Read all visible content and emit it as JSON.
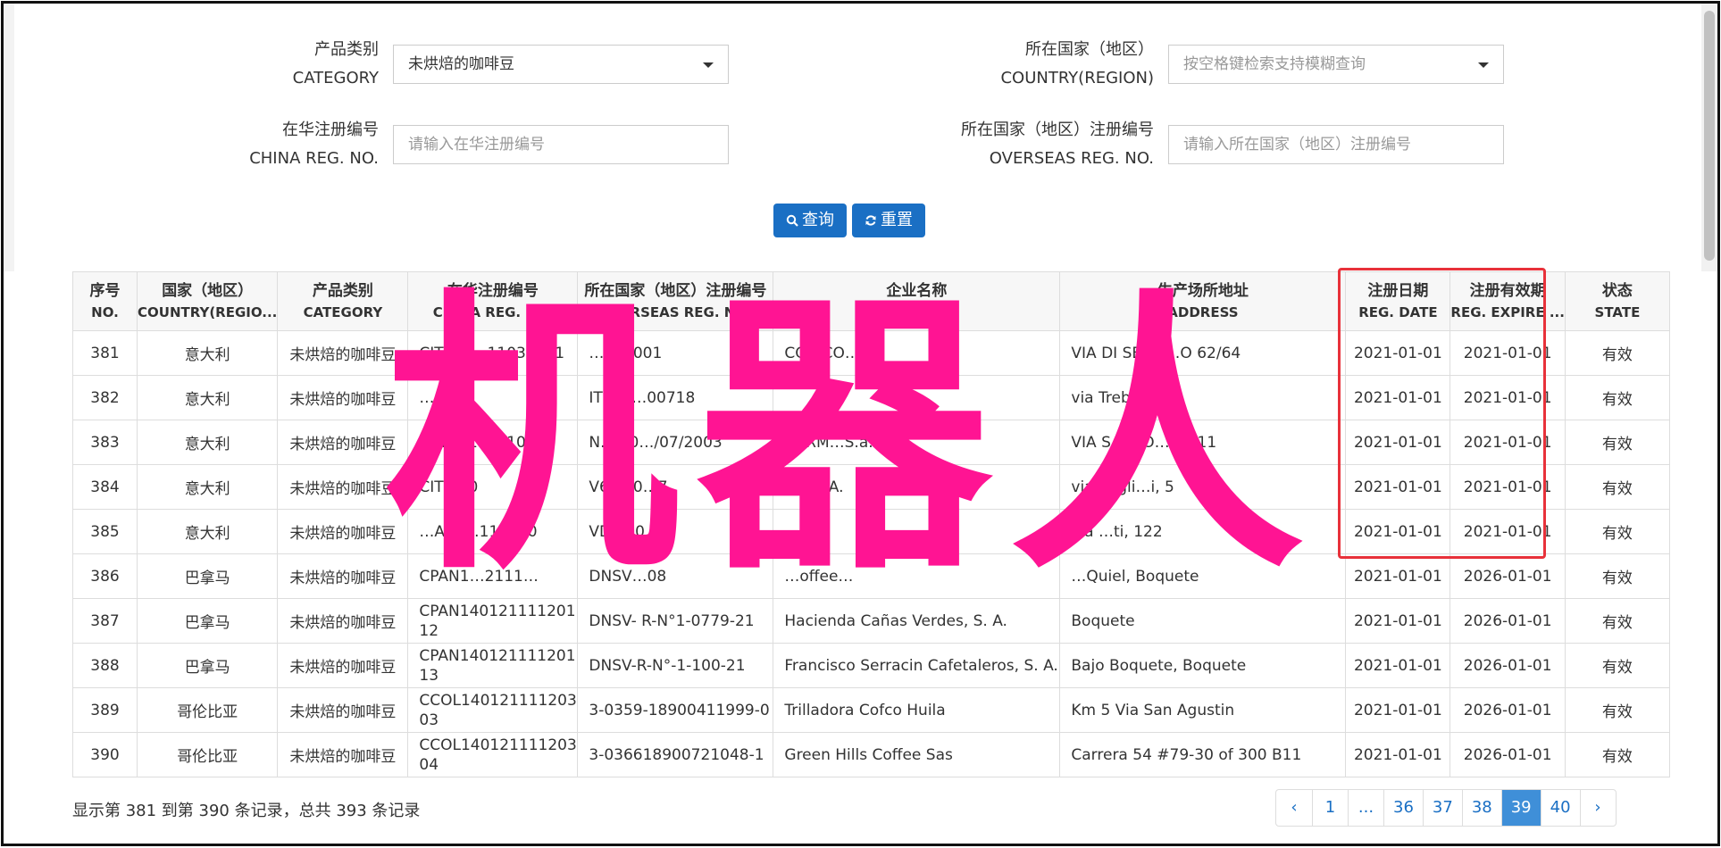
{
  "filters": {
    "category": {
      "label_cn": "产品类别",
      "label_en": "CATEGORY",
      "value": "未烘焙的咖啡豆"
    },
    "country": {
      "label_cn": "所在国家（地区）",
      "label_en": "COUNTRY(REGION)",
      "placeholder": "按空格键检索支持模糊查询"
    },
    "china_reg": {
      "label_cn": "在华注册编号",
      "label_en": "CHINA REG. NO.",
      "placeholder": "请输入在华注册编号"
    },
    "overseas_reg": {
      "label_cn": "所在国家（地区）注册编号",
      "label_en": "OVERSEAS REG. NO.",
      "placeholder": "请输入所在国家（地区）注册编号"
    }
  },
  "buttons": {
    "search": "查询",
    "reset": "重置"
  },
  "table": {
    "headers": [
      {
        "cn": "序号",
        "en": "NO."
      },
      {
        "cn": "国家（地区）",
        "en": "COUNTRY(REGIO..."
      },
      {
        "cn": "产品类别",
        "en": "CATEGORY"
      },
      {
        "cn": "在华注册编号",
        "en": "CHINA REG. NO."
      },
      {
        "cn": "所在国家（地区）注册编号",
        "en": "OVERSEAS REG. NO."
      },
      {
        "cn": "企业名称",
        "en": "NAME"
      },
      {
        "cn": "生产场所地址",
        "en": "ADDRESS"
      },
      {
        "cn": "注册日期",
        "en": "REG. DATE"
      },
      {
        "cn": "注册有效期",
        "en": "REG. EXPIRE ..."
      },
      {
        "cn": "状态",
        "en": "STATE"
      }
    ],
    "rows": [
      [
        "381",
        "意大利",
        "未烘焙的咖啡豆",
        "CITA14…11031001",
        "…500001",
        "CO…CO…",
        "VIA DI SEMB…O 62/64",
        "2021-01-01",
        "2021-01-01",
        "有效"
      ],
      [
        "382",
        "意大利",
        "未烘焙的咖啡豆",
        "…001",
        "IT205…00718",
        "",
        "via Trebbia 2…",
        "2021-01-01",
        "2021-01-01",
        "有效"
      ],
      [
        "383",
        "意大利",
        "未烘焙的咖啡豆",
        "CITA…11031001",
        "N. 760…/07/2003",
        "TORM…S.a.a",
        "VIA SACCO…TTI 11",
        "2021-01-01",
        "2021-01-01",
        "有效"
      ],
      [
        "384",
        "意大利",
        "未烘焙的咖啡豆",
        "CIT…00",
        "V69.00…7",
        "…S.p.A.",
        "via degli…i, 5",
        "2021-01-01",
        "2021-01-01",
        "有效"
      ],
      [
        "385",
        "意大利",
        "未烘焙的咖啡豆",
        "…A14…110310",
        "VD6.00…7",
        "…A.",
        "via …ti, 122",
        "2021-01-01",
        "2021-01-01",
        "有效"
      ],
      [
        "386",
        "巴拿马",
        "未烘焙的咖啡豆",
        "CPAN1…2111…",
        "DNSV…08",
        "…offee…",
        "…Quiel, Boquete",
        "2021-01-01",
        "2026-01-01",
        "有效"
      ],
      [
        "387",
        "巴拿马",
        "未烘焙的咖啡豆",
        "CPAN14012111120112",
        "DNSV- R-N°1-0779-21",
        "Hacienda Cañas Verdes, S. A.",
        "Boquete",
        "2021-01-01",
        "2026-01-01",
        "有效"
      ],
      [
        "388",
        "巴拿马",
        "未烘焙的咖啡豆",
        "CPAN14012111120113",
        "DNSV-R-N°-1-100-21",
        "Francisco Serracin Cafetaleros, S. A.",
        "Bajo Boquete, Boquete",
        "2021-01-01",
        "2026-01-01",
        "有效"
      ],
      [
        "389",
        "哥伦比亚",
        "未烘焙的咖啡豆",
        "CCOL14012111120303",
        "3-0359-18900411999-0",
        "Trilladora Cofco Huila",
        "Km 5 Via San Agustin",
        "2021-01-01",
        "2026-01-01",
        "有效"
      ],
      [
        "390",
        "哥伦比亚",
        "未烘焙的咖啡豆",
        "CCOL14012111120304",
        "3-036618900721048-1",
        "Green Hills Coffee Sas",
        "Carrera 54 #79-30 of 300 B11",
        "2021-01-01",
        "2026-01-01",
        "有效"
      ]
    ]
  },
  "watermark": "机器人",
  "footer": {
    "summary": "显示第 381 到第 390 条记录，总共 393 条记录"
  },
  "pagination": [
    "‹",
    "1",
    "...",
    "36",
    "37",
    "38",
    "39",
    "40",
    "›"
  ],
  "pagination_active": "39",
  "colors": {
    "primary": "#1a6fc4",
    "highlight_box": "#e8313a",
    "watermark": "#ff1493"
  }
}
